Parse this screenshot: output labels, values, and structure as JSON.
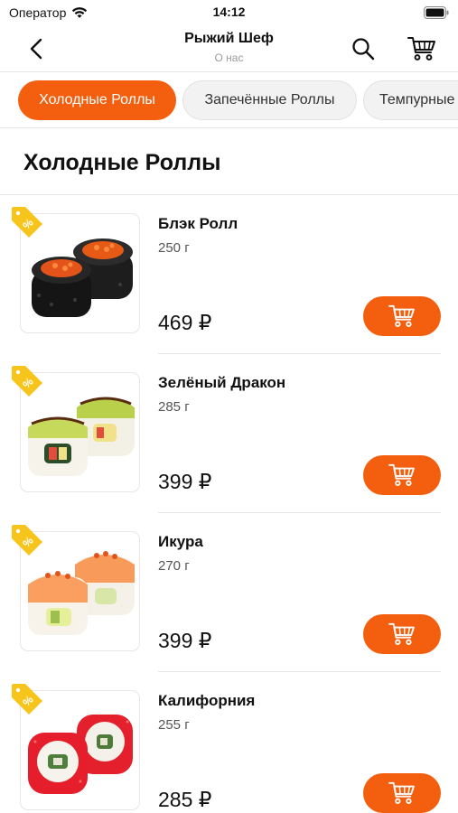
{
  "status_bar": {
    "carrier": "Оператор",
    "time": "14:12"
  },
  "nav": {
    "title": "Рыжий Шеф",
    "subtitle": "О нас"
  },
  "tabs": [
    {
      "label": "Холодные Роллы",
      "active": true
    },
    {
      "label": "Запечённые Роллы",
      "active": false
    },
    {
      "label": "Темпурные Роллы",
      "active": false
    }
  ],
  "section_title": "Холодные Роллы",
  "products": [
    {
      "name": "Блэк Ролл",
      "weight": "250 г",
      "price": "469 ₽"
    },
    {
      "name": "Зелёный Дракон",
      "weight": "285 г",
      "price": "399 ₽"
    },
    {
      "name": "Икура",
      "weight": "270 г",
      "price": "399 ₽"
    },
    {
      "name": "Калифорния",
      "weight": "255 г",
      "price": "285 ₽"
    }
  ],
  "colors": {
    "accent": "#f35f0e",
    "discount_tag": "#f6c41a",
    "divider": "#e4e4e4"
  }
}
